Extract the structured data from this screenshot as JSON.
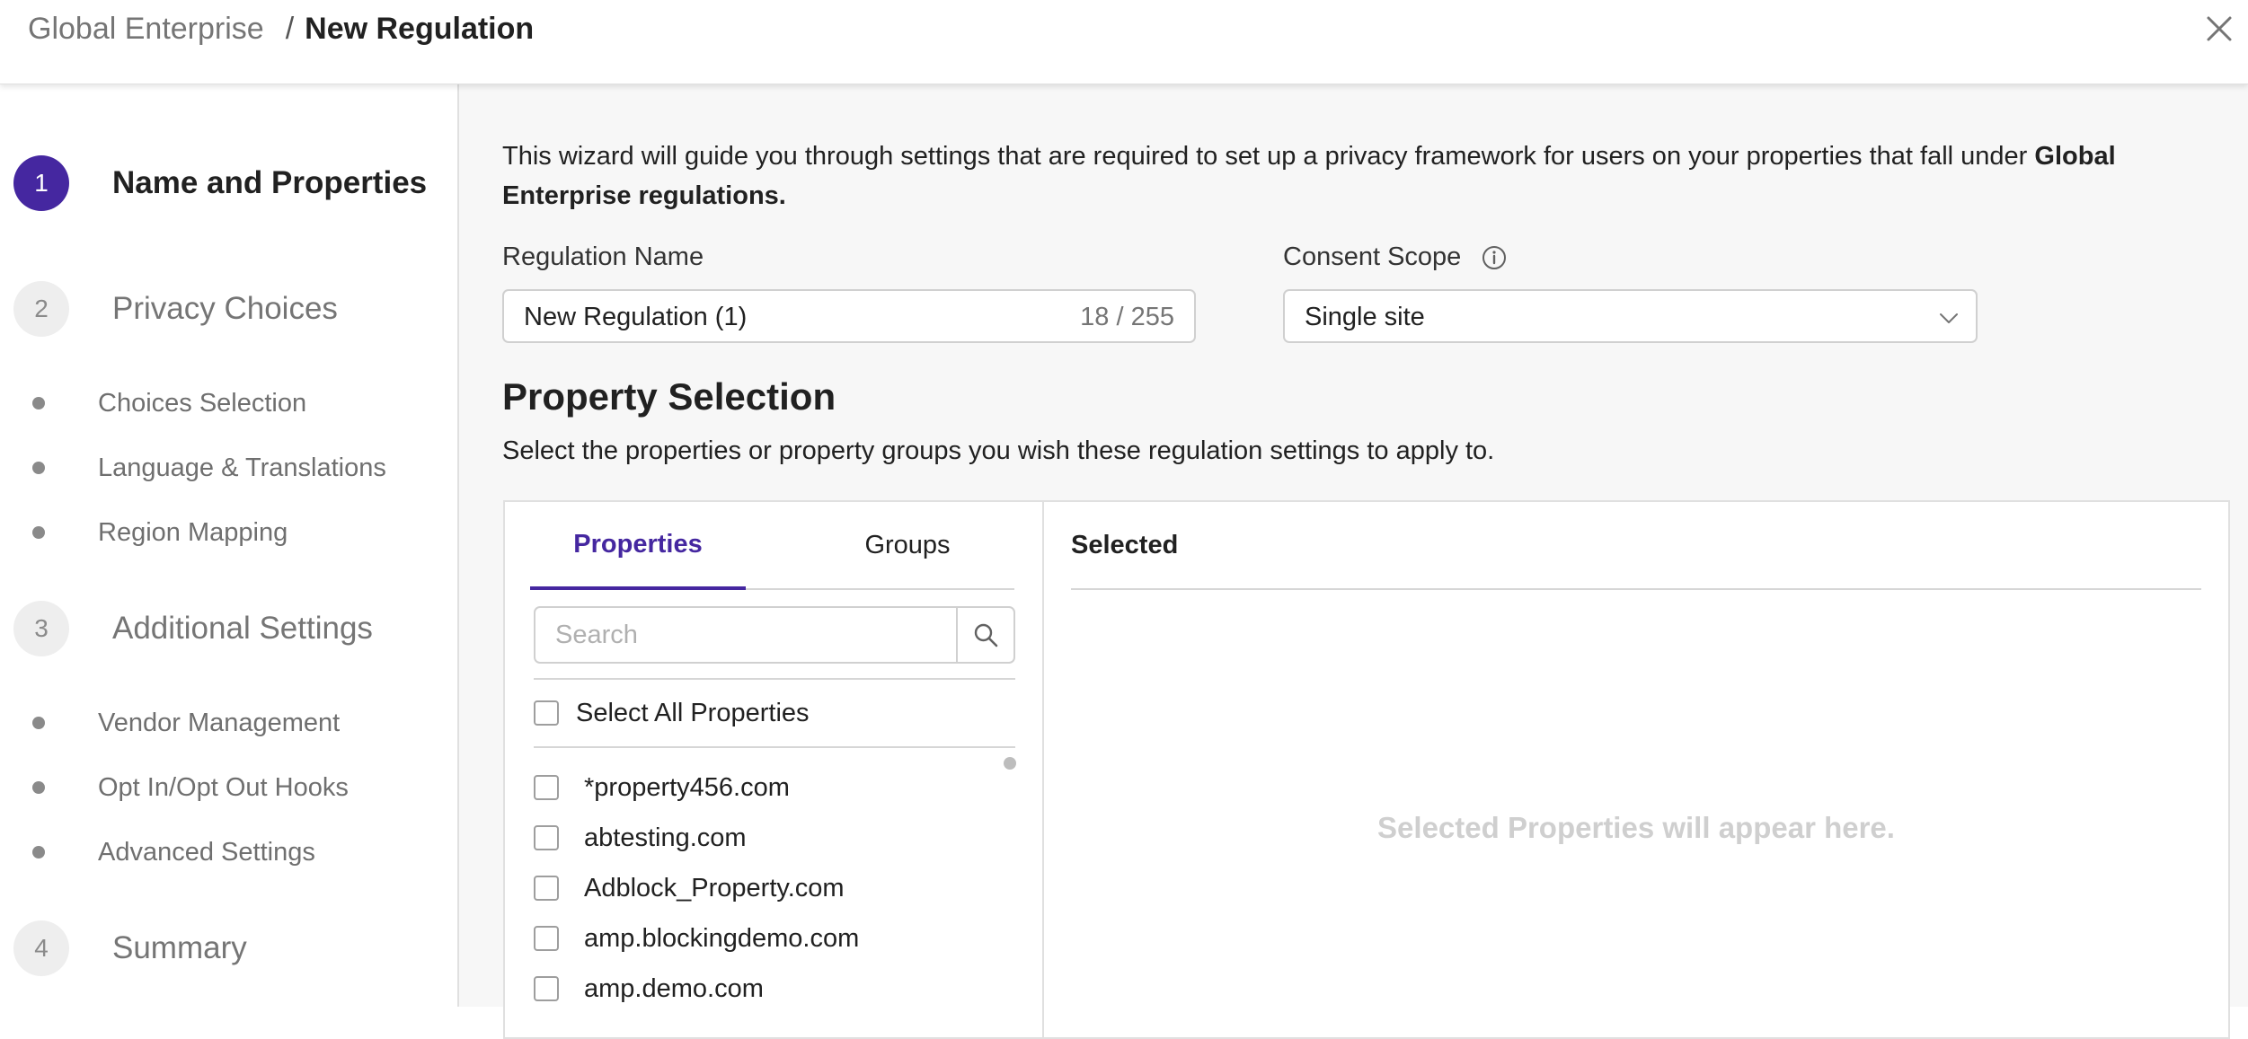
{
  "header": {
    "breadcrumb_root": "Global Enterprise",
    "breadcrumb_separator": "/",
    "breadcrumb_current": "New Regulation",
    "close_icon": "close-icon"
  },
  "sidebar": {
    "steps": [
      {
        "number": "1",
        "label": "Name and Properties",
        "active": true
      },
      {
        "number": "2",
        "label": "Privacy Choices",
        "active": false
      },
      {
        "number": "3",
        "label": "Additional Settings",
        "active": false
      },
      {
        "number": "4",
        "label": "Summary",
        "active": false
      }
    ],
    "substeps_privacy": [
      "Choices Selection",
      "Language & Translations",
      "Region Mapping"
    ],
    "substeps_additional": [
      "Vendor Management",
      "Opt In/Opt Out Hooks",
      "Advanced Settings"
    ]
  },
  "main": {
    "intro_text": "This wizard will guide you through settings that are required to set up a privacy framework for users on your properties that fall under ",
    "intro_bold": "Global Enterprise regulations.",
    "regulation_name": {
      "label": "Regulation Name",
      "value": "New Regulation (1)",
      "char_count": "18 / 255"
    },
    "consent_scope": {
      "label": "Consent Scope",
      "value": "Single site",
      "info_icon": "info-icon"
    },
    "property_selection": {
      "title": "Property Selection",
      "description": "Select the properties or property groups you wish these regulation settings to apply to.",
      "tabs": [
        "Properties",
        "Groups"
      ],
      "active_tab": "Properties",
      "search_placeholder": "Search",
      "select_all_label": "Select All Properties",
      "properties": [
        "*property456.com",
        "abtesting.com",
        "Adblock_Property.com",
        "amp.blockingdemo.com",
        "amp.demo.com"
      ],
      "selected_header": "Selected",
      "empty_state": "Selected Properties will appear here."
    }
  },
  "colors": {
    "accent": "#4527a0",
    "muted_text": "#757575",
    "border": "#d0d0d0",
    "main_bg": "#f7f7f7"
  }
}
